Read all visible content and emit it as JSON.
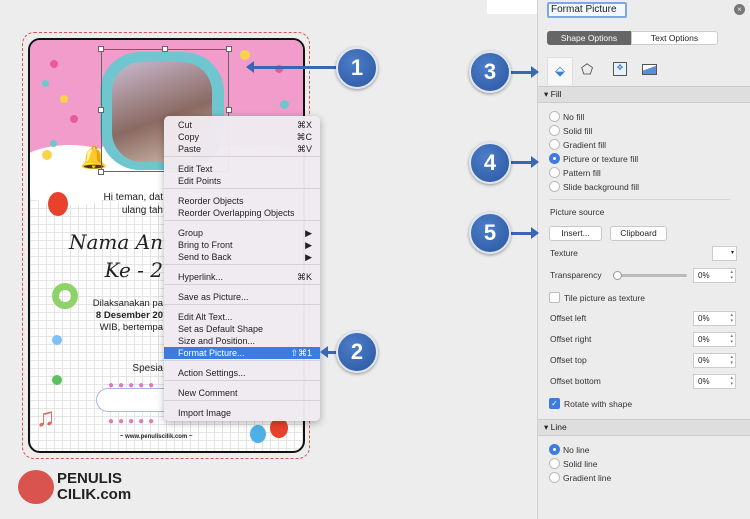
{
  "card": {
    "greeting_1": "Hi teman, dat",
    "greeting_2": "ulang tah",
    "name": "Nama An",
    "age": "Ke - 2",
    "detail_1": "Dilaksanakan pa",
    "detail_2": "8 Desember 20",
    "detail_3": "WIB, bertempa",
    "special": "Spesia",
    "website": "~ www.penuliscilik.com ~"
  },
  "context_menu": {
    "items": [
      {
        "label": "Cut",
        "shortcut": "⌘X"
      },
      {
        "label": "Copy",
        "shortcut": "⌘C"
      },
      {
        "label": "Paste",
        "shortcut": "⌘V"
      },
      {
        "label": "Edit Text"
      },
      {
        "label": "Edit Points"
      },
      {
        "label": "Reorder Objects"
      },
      {
        "label": "Reorder Overlapping Objects"
      },
      {
        "label": "Group",
        "shortcut": "▶"
      },
      {
        "label": "Bring to Front",
        "shortcut": "▶"
      },
      {
        "label": "Send to Back",
        "shortcut": "▶"
      },
      {
        "label": "Hyperlink...",
        "shortcut": "⌘K"
      },
      {
        "label": "Save as Picture..."
      },
      {
        "label": "Edit Alt Text..."
      },
      {
        "label": "Set as Default Shape"
      },
      {
        "label": "Size and Position..."
      },
      {
        "label": "Format Picture...",
        "shortcut": "⇧⌘1",
        "highlighted": true
      },
      {
        "label": "Action Settings..."
      },
      {
        "label": "New Comment"
      },
      {
        "label": "Import Image"
      }
    ]
  },
  "callouts": [
    "1",
    "2",
    "3",
    "4",
    "5"
  ],
  "logo": {
    "line1": "PENULIS",
    "line2": "CILIK.com"
  },
  "panel": {
    "title": "Format Picture",
    "tabs": [
      "Shape Options",
      "Text Options"
    ],
    "active_tab": "Shape Options",
    "icons": [
      "fill-line-icon",
      "effects-pentagon-icon",
      "size-properties-icon",
      "picture-icon"
    ],
    "fill": {
      "header": "Fill",
      "options": [
        "No fill",
        "Solid fill",
        "Gradient fill",
        "Picture or texture fill",
        "Pattern fill",
        "Slide background fill"
      ],
      "selected": "Picture or texture fill",
      "picture_source": "Picture source",
      "insert": "Insert...",
      "clipboard": "Clipboard",
      "texture": "Texture",
      "transparency": "Transparency",
      "transparency_value": "0%",
      "tile": "Tile picture as texture",
      "tile_checked": false,
      "offset_left": "Offset left",
      "offset_left_value": "0%",
      "offset_right": "Offset right",
      "offset_right_value": "0%",
      "offset_top": "Offset top",
      "offset_top_value": "0%",
      "offset_bottom": "Offset bottom",
      "offset_bottom_value": "0%",
      "rotate": "Rotate with shape",
      "rotate_checked": true
    },
    "line": {
      "header": "Line",
      "options": [
        "No line",
        "Solid line",
        "Gradient line"
      ],
      "selected": "No line"
    }
  },
  "colors": {
    "accent": "#3d7be0",
    "callout": "#2f5ea8",
    "pink": "#f29ccb"
  }
}
